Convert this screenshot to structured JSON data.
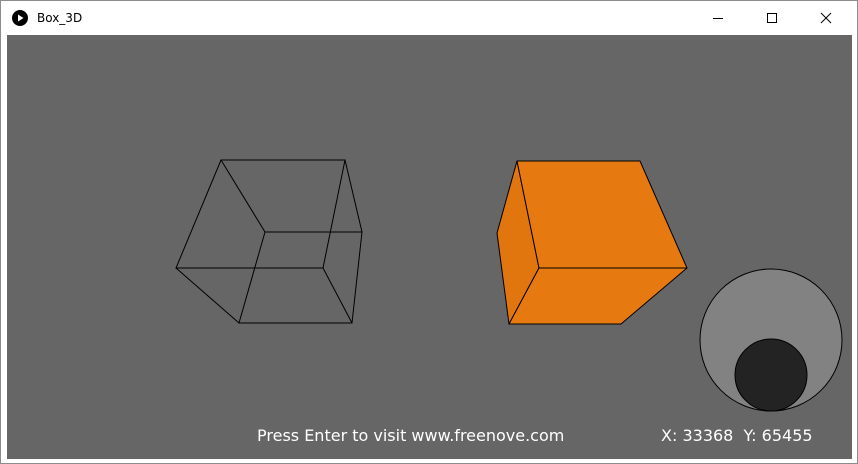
{
  "window": {
    "title": "Box_3D",
    "app_icon": "processing-play-icon",
    "controls": {
      "minimize_icon": "minimize-icon",
      "maximize_icon": "maximize-icon",
      "close_icon": "close-icon"
    }
  },
  "canvas": {
    "background_color": "#666666",
    "wireframe_box": {
      "stroke_color": "#000000",
      "fill": "none"
    },
    "solid_box": {
      "fill_color": "#E67A10",
      "stroke_color": "#000000"
    },
    "joystick": {
      "base_color": "#828282",
      "knob_color": "#232323",
      "outline_color": "#000000"
    },
    "footer": {
      "press_enter_text": "Press Enter to visit www.freenove.com",
      "x_label": "X:",
      "x_value": "33368",
      "y_label": "Y:",
      "y_value": "65455",
      "text_color": "#FFFFFF"
    }
  }
}
